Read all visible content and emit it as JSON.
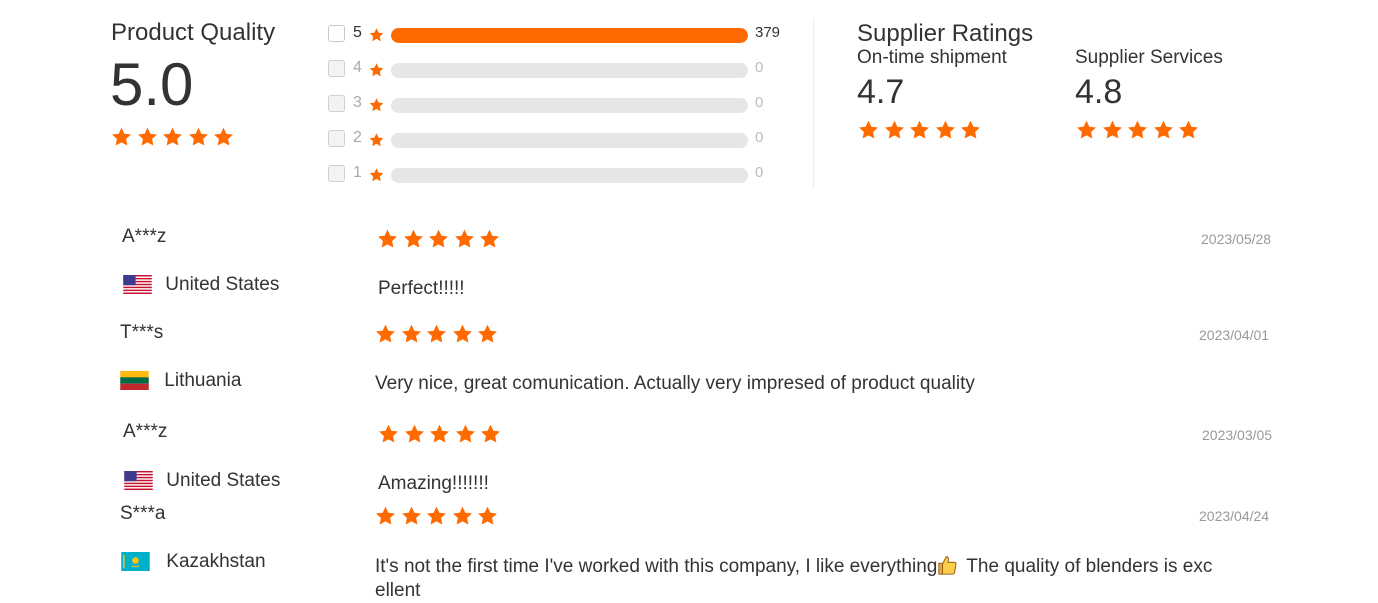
{
  "product_quality": {
    "title": "Product Quality",
    "score": "5.0",
    "stars": 5
  },
  "histogram": [
    {
      "level": "5",
      "count": "379",
      "fraction": 1.0
    },
    {
      "level": "4",
      "count": "0",
      "fraction": 0
    },
    {
      "level": "3",
      "count": "0",
      "fraction": 0
    },
    {
      "level": "2",
      "count": "0",
      "fraction": 0
    },
    {
      "level": "1",
      "count": "0",
      "fraction": 0
    }
  ],
  "supplier_ratings": {
    "title": "Supplier Ratings",
    "on_time": {
      "label": "On-time shipment",
      "score": "4.7",
      "stars": 5
    },
    "services": {
      "label": "Supplier Services",
      "score": "4.8",
      "stars": 5
    }
  },
  "reviews": [
    {
      "name": "A***z",
      "country": "United States",
      "flag": "us-flag-icon",
      "stars": 5,
      "date": "2023/05/28",
      "text": "Perfect!!!!!"
    },
    {
      "name": "T***s",
      "country": "Lithuania",
      "flag": "lt-flag-icon",
      "stars": 5,
      "date": "2023/04/01",
      "text": "Very nice, great comunication. Actually very impresed of product quality"
    },
    {
      "name": "A***z",
      "country": "United States",
      "flag": "us-flag-icon",
      "stars": 5,
      "date": "2023/03/05",
      "text": "Amazing!!!!!!!"
    },
    {
      "name": "S***a",
      "country": "Kazakhstan",
      "flag": "kz-flag-icon",
      "stars": 5,
      "date": "2023/04/24",
      "text_line1": "It's not the first time I've worked with this company, I like everything",
      "text_emoji": "thumbs-up-icon",
      "text_line1_after": " The quality of blenders is exc",
      "text_line2": "ellent"
    }
  ],
  "colors": {
    "accent": "#ff6a00",
    "track": "#e6e6e6",
    "date": "#999999"
  }
}
